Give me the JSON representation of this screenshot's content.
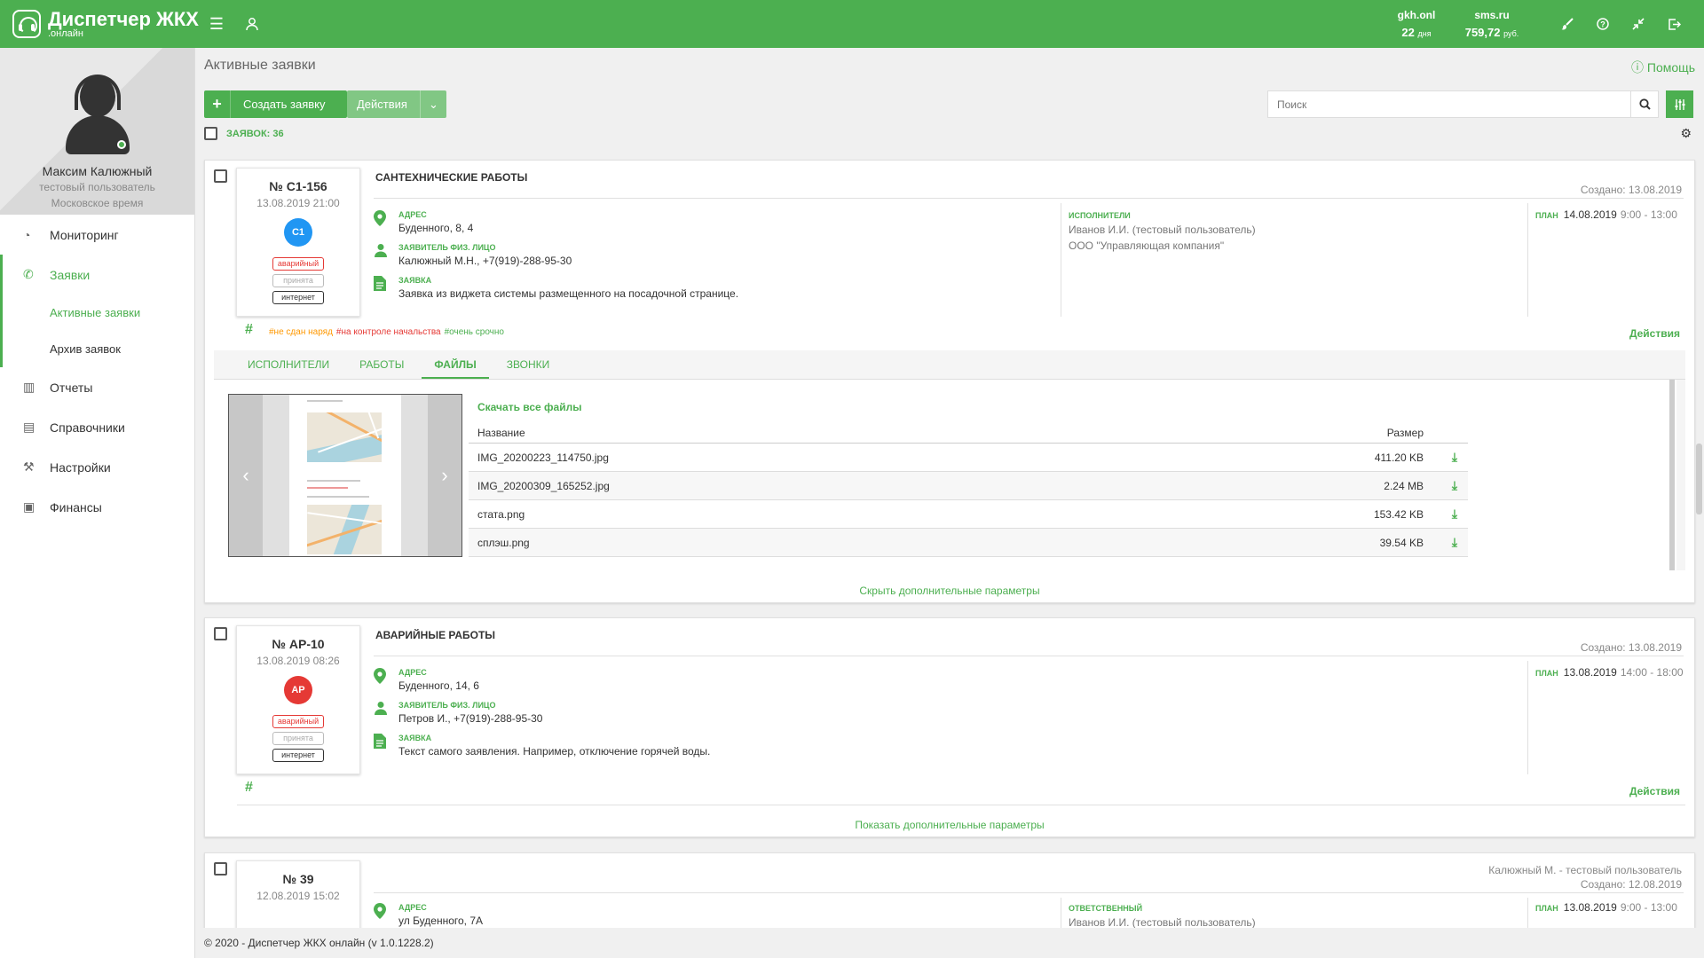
{
  "app": {
    "title": "Диспетчер ЖКХ",
    "subtitle": ".онлайн",
    "stats": [
      {
        "name": "gkh.onl",
        "value": "22",
        "unit": "дня"
      },
      {
        "name": "sms.ru",
        "value": "759,72",
        "unit": "руб."
      }
    ]
  },
  "profile": {
    "name": "Максим Калюжный",
    "role": "тестовый пользователь",
    "timezone": "Московское время"
  },
  "nav": {
    "monitoring": "Мониторинг",
    "requests": "Заявки",
    "active_requests": "Активные заявки",
    "archive": "Архив заявок",
    "reports": "Отчеты",
    "directories": "Справочники",
    "settings": "Настройки",
    "finances": "Финансы"
  },
  "page": {
    "title": "Активные заявки",
    "help": "Помощь",
    "create_button": "Создать заявку",
    "actions_button": "Действия",
    "search_placeholder": "Поиск",
    "count_label": "ЗАЯВОК: 36"
  },
  "labels": {
    "address": "АДРЕС",
    "applicant": "ЗАЯВИТЕЛЬ ФИЗ. ЛИЦО",
    "request": "ЗАЯВКА",
    "executors": "ИСПОЛНИТЕЛИ",
    "responsible": "ОТВЕТСТВЕННЫЙ",
    "plan": "ПЛАН",
    "actions": "Действия",
    "hash": "#"
  },
  "cards": [
    {
      "number": "№ С1-156",
      "date": "13.08.2019 21:00",
      "badge": "С1",
      "badge_color": "#2196f3",
      "tags": [
        "аварийный",
        "принята",
        "интернет"
      ],
      "title": "САНТЕХНИЧЕСКИЕ РАБОТЫ",
      "created": "Создано: 13.08.2019",
      "address": "Буденного, 8, 4",
      "applicant": "Калюжный М.Н., +7(919)-288-95-30",
      "request": "Заявка из виджета системы размещенного на посадочной странице.",
      "executors": [
        "Иванов И.И. (тестовый пользователь)",
        "ООО \"Управляющая компания\""
      ],
      "plan_date": "14.08.2019",
      "plan_time": "9:00 - 13:00",
      "hashtags": [
        {
          "text": "#не сдан наряд",
          "color": "#ff9800"
        },
        {
          "text": "#на контроле начальства",
          "color": "#e53935"
        },
        {
          "text": "#очень срочно",
          "color": "#4caf50"
        }
      ],
      "tabs": [
        "ИСПОЛНИТЕЛИ",
        "РАБОТЫ",
        "ФАЙЛЫ",
        "ЗВОНКИ"
      ],
      "download_all": "Скачать все файлы",
      "files_header": {
        "name": "Название",
        "size": "Размер"
      },
      "files": [
        {
          "name": "IMG_20200223_114750.jpg",
          "size": "411.20 KB"
        },
        {
          "name": "IMG_20200309_165252.jpg",
          "size": "2.24 MB"
        },
        {
          "name": "стата.png",
          "size": "153.42 KB"
        },
        {
          "name": "сплэш.png",
          "size": "39.54 KB"
        }
      ],
      "toggle": "Скрыть дополнительные параметры"
    },
    {
      "number": "№ АР-10",
      "date": "13.08.2019 08:26",
      "badge": "АР",
      "badge_color": "#e53935",
      "tags": [
        "аварийный",
        "принята",
        "интернет"
      ],
      "title": "АВАРИЙНЫЕ РАБОТЫ",
      "created": "Создано: 13.08.2019",
      "address": "Буденного, 14, 6",
      "applicant": "Петров И., +7(919)-288-95-30",
      "request": "Текст самого заявления. Например, отключение горячей воды.",
      "plan_date": "13.08.2019",
      "plan_time": "14:00 - 18:00",
      "toggle": "Показать дополнительные параметры"
    },
    {
      "number": "№ 39",
      "date": "12.08.2019 15:02",
      "author": "Калюжный М. - тестовый пользователь",
      "created": "Создано: 12.08.2019",
      "address": "ул Буденного, 7А",
      "responsible": "Иванов И.И. (тестовый пользователь)",
      "plan_date": "13.08.2019",
      "plan_time": "9:00 - 13:00"
    }
  ],
  "footer": "© 2020 - Диспетчер ЖКХ онлайн (v 1.0.1228.2)",
  "colors": {
    "brand": "#4caf50",
    "brand_light": "#81c784",
    "danger": "#e53935",
    "info": "#2196f3"
  }
}
